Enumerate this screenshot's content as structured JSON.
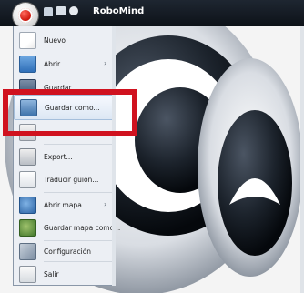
{
  "window": {
    "title": "RoboMind"
  },
  "menu": {
    "items": [
      {
        "label": "Nuevo",
        "icon": "new-document-icon"
      },
      {
        "label": "Abrir",
        "icon": "folder-open-icon",
        "submenu": true
      },
      {
        "label": "Guardar",
        "icon": "save-icon"
      },
      {
        "label": "Guardar como...",
        "icon": "save-as-icon"
      },
      {
        "label": "",
        "icon": "print-icon"
      },
      {
        "label": "Export...",
        "icon": "export-icon"
      },
      {
        "label": "Traducir guion...",
        "icon": "translate-icon"
      },
      {
        "label": "Abrir mapa",
        "icon": "open-map-icon",
        "submenu": true
      },
      {
        "label": "Guardar mapa como...",
        "icon": "save-map-icon"
      },
      {
        "label": "Configuración",
        "icon": "settings-icon"
      },
      {
        "label": "Salir",
        "icon": "exit-icon"
      }
    ],
    "submenu_arrow": "›"
  },
  "colors": {
    "highlight": "#d0121f",
    "menu_background": "#eceff4"
  }
}
